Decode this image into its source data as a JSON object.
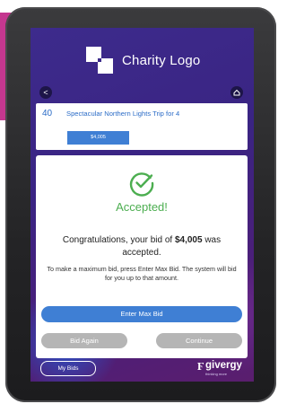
{
  "header": {
    "logo_text": "Charity Logo",
    "back_icon": "chevron-left-icon",
    "home_icon": "home-icon"
  },
  "item": {
    "number": "40",
    "title": "Spectacular Northern Lights Trip for 4",
    "price": "$4,005"
  },
  "modal": {
    "icon": "check-circle-icon",
    "status": "Accepted!",
    "message_prefix": "Congratulations, your bid of ",
    "bid_amount": "$4,005",
    "message_suffix": " was accepted.",
    "info": "To make a maximum bid, press Enter Max Bid. The system will bid for you up to that amount.",
    "enter_max_bid_label": "Enter Max Bid",
    "bid_again_label": "Bid Again",
    "continue_label": "Continue"
  },
  "footer": {
    "my_bids_label": "My Bids",
    "brand_name": "givergy",
    "brand_tagline": "thinking more"
  },
  "colors": {
    "accent_blue": "#3f7fd4",
    "success_green": "#4cae50",
    "screen_purple": "#3d2b8c",
    "disabled_grey": "#b5b5b5"
  }
}
